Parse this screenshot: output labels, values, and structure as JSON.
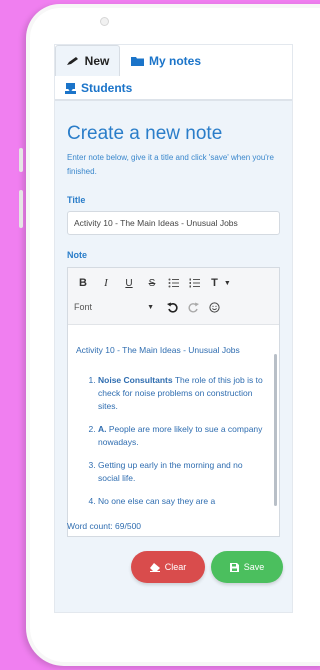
{
  "tabs": [
    {
      "label": "New",
      "icon": "pen-icon",
      "active": true
    },
    {
      "label": "My notes",
      "icon": "folder-icon",
      "active": false
    },
    {
      "label": "Students",
      "icon": "students-icon",
      "active": false
    }
  ],
  "page": {
    "title": "Create a new note",
    "instructions": "Enter note below, give it a title and click 'save' when you're finished."
  },
  "form": {
    "title_label": "Title",
    "title_value": "Activity 10 - The Main Ideas - Unusual Jobs",
    "note_label": "Note"
  },
  "toolbar": {
    "bold": "B",
    "italic": "I",
    "underline": "U",
    "strike": "S",
    "text_style": "T",
    "font_label": "Font"
  },
  "note": {
    "heading": "Activity 10 - The Main Ideas - Unusual Jobs",
    "items": [
      {
        "bold": "Noise Consultants",
        "text": " The role of this job is to check for noise problems on construction sites."
      },
      {
        "bold": "A.",
        "text": " People are more likely to sue a company nowadays."
      },
      {
        "bold": "",
        "text": "Getting up early in the morning and no social life."
      },
      {
        "bold": "",
        "text": "No one else can say they are a"
      }
    ]
  },
  "word_count": "Word count: 69/500",
  "buttons": {
    "clear": "Clear",
    "save": "Save"
  },
  "colors": {
    "accent": "#2a7dc9",
    "clear": "#d94c4c",
    "save": "#4bbf5e",
    "background": "#f07ff0"
  }
}
